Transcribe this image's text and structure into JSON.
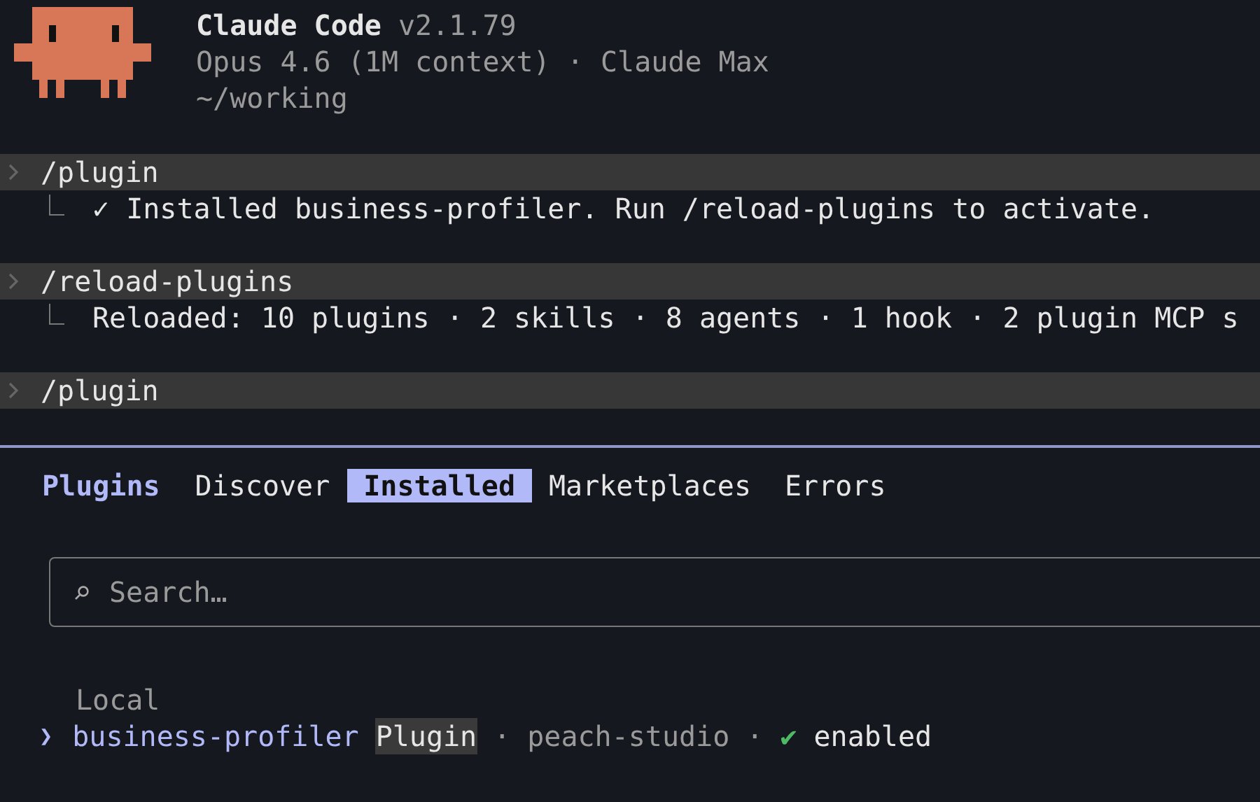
{
  "header": {
    "title": "Claude Code",
    "version": "v2.1.79",
    "model_line": "Opus 4.6 (1M context) · Claude Max",
    "cwd": "~/working"
  },
  "history": [
    {
      "command": "/plugin",
      "result": "✓ Installed business-profiler. Run /reload-plugins to activate."
    },
    {
      "command": "/reload-plugins",
      "result": "Reloaded: 10 plugins · 2 skills · 8 agents · 1 hook · 2 plugin MCP s"
    },
    {
      "command": "/plugin"
    }
  ],
  "panel": {
    "title": "Plugins",
    "tabs": [
      {
        "label": "Discover",
        "selected": false
      },
      {
        "label": "Installed",
        "selected": true
      },
      {
        "label": "Marketplaces",
        "selected": false
      },
      {
        "label": "Errors",
        "selected": false
      }
    ],
    "search": {
      "placeholder": "Search…"
    },
    "separator": "·",
    "sections": [
      {
        "title": "Local",
        "items": [
          {
            "pointer": "❯",
            "name": "business-profiler",
            "type": "Plugin",
            "source": "peach-studio",
            "status_icon": "✔",
            "status": "enabled",
            "enabled": true,
            "selected": true
          }
        ]
      }
    ]
  }
}
